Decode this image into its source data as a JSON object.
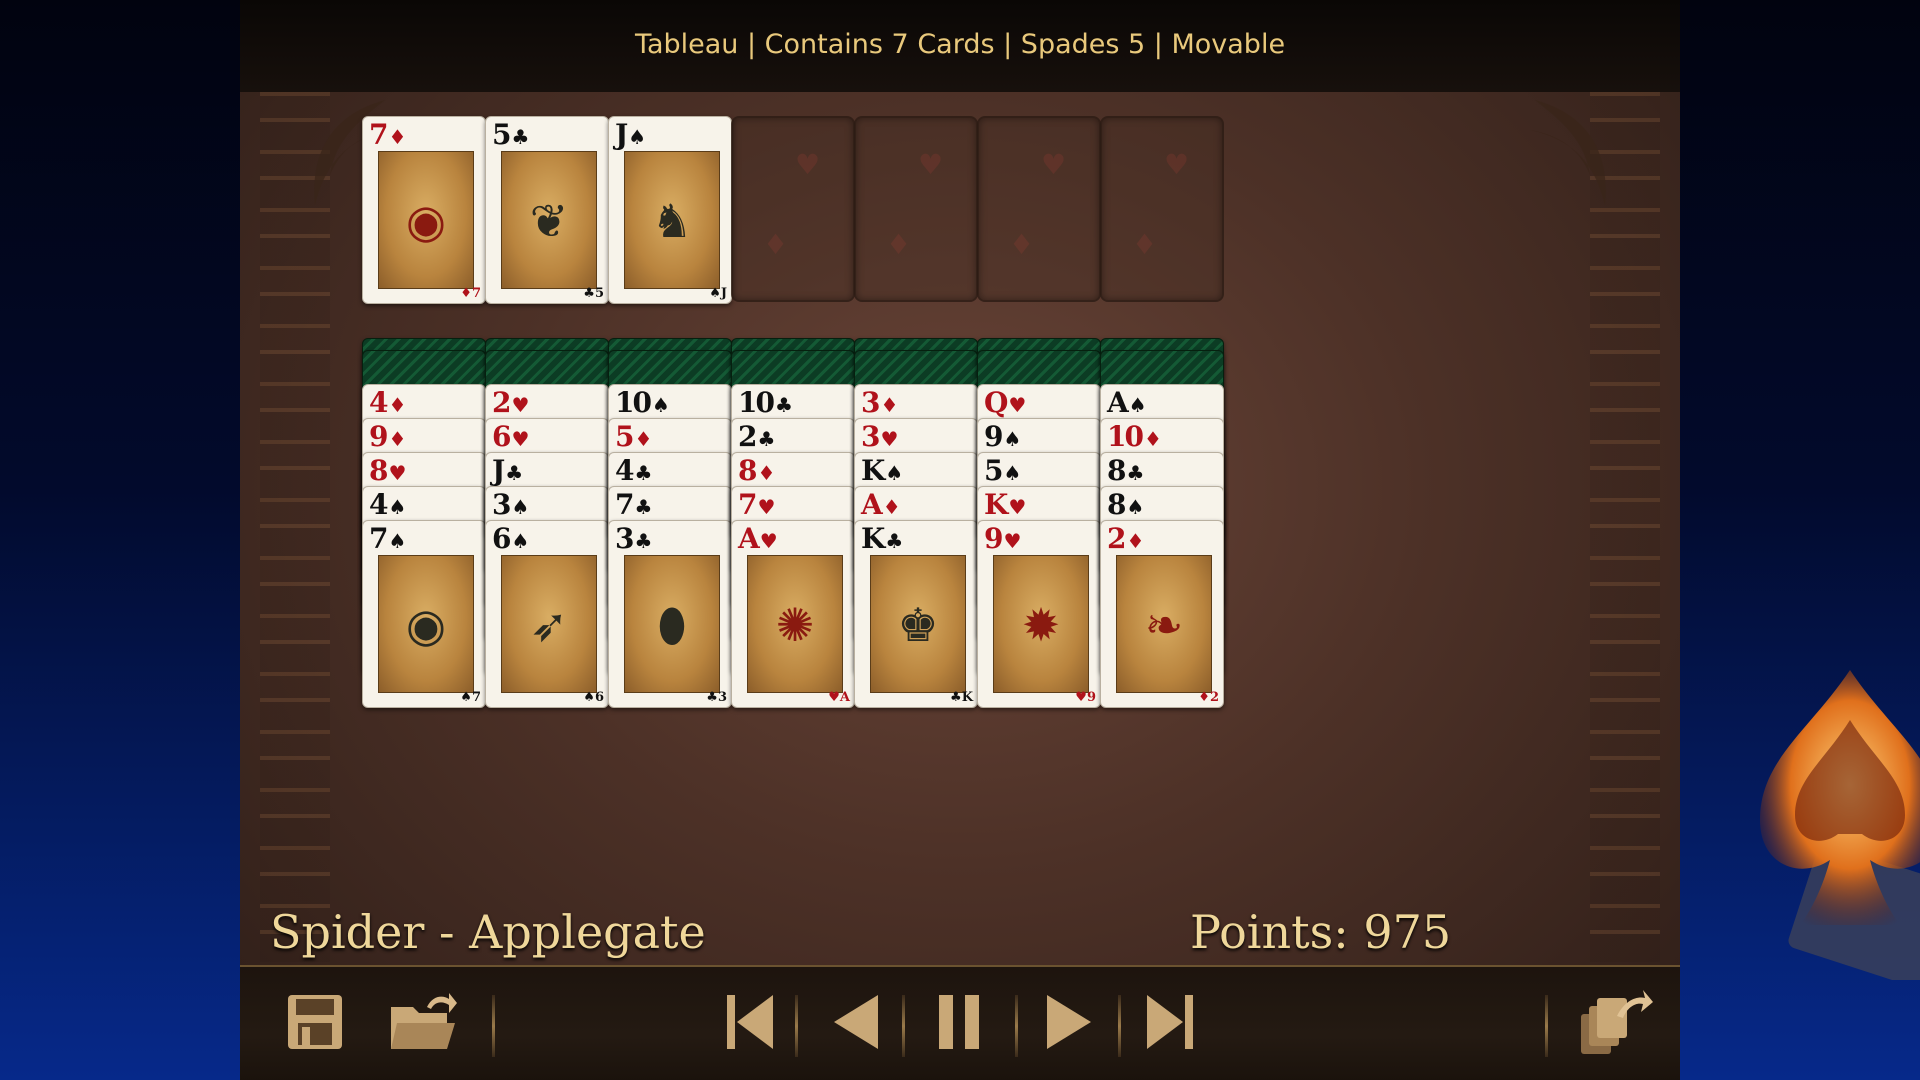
{
  "status": {
    "text": "Tableau | Contains 7 Cards | Spades 5 | Movable"
  },
  "game": {
    "title": "Spider - Applegate",
    "score_label": "Points: 975"
  },
  "colors": {
    "accent": "#e9c97c",
    "red_suit": "#b0121b",
    "black_suit": "#111111",
    "felt": "#4d3127"
  },
  "foundation": [
    {
      "rank": "7",
      "suit": "♦",
      "color": "red",
      "art": "shield"
    },
    {
      "rank": "5",
      "suit": "♣",
      "color": "black",
      "art": "necklace"
    },
    {
      "rank": "J",
      "suit": "♠",
      "color": "black",
      "art": "warrior"
    },
    {
      "empty": true
    },
    {
      "empty": true
    },
    {
      "empty": true
    },
    {
      "empty": true
    }
  ],
  "tableau": [
    {
      "facedown": 2,
      "cards": [
        {
          "rank": "4",
          "suit": "♦",
          "color": "red"
        },
        {
          "rank": "9",
          "suit": "♦",
          "color": "red"
        },
        {
          "rank": "8",
          "suit": "♥",
          "color": "red"
        },
        {
          "rank": "4",
          "suit": "♠",
          "color": "black"
        },
        {
          "rank": "7",
          "suit": "♠",
          "color": "black",
          "art": "shield"
        }
      ]
    },
    {
      "facedown": 2,
      "cards": [
        {
          "rank": "2",
          "suit": "♥",
          "color": "red"
        },
        {
          "rank": "6",
          "suit": "♥",
          "color": "red"
        },
        {
          "rank": "J",
          "suit": "♣",
          "color": "black"
        },
        {
          "rank": "3",
          "suit": "♠",
          "color": "black"
        },
        {
          "rank": "6",
          "suit": "♠",
          "color": "black",
          "art": "quiver"
        }
      ]
    },
    {
      "facedown": 2,
      "cards": [
        {
          "rank": "10",
          "suit": "♠",
          "color": "black"
        },
        {
          "rank": "5",
          "suit": "♦",
          "color": "red"
        },
        {
          "rank": "4",
          "suit": "♣",
          "color": "black"
        },
        {
          "rank": "7",
          "suit": "♣",
          "color": "black"
        },
        {
          "rank": "3",
          "suit": "♣",
          "color": "black",
          "art": "cocoa"
        }
      ]
    },
    {
      "facedown": 2,
      "cards": [
        {
          "rank": "10",
          "suit": "♣",
          "color": "black"
        },
        {
          "rank": "2",
          "suit": "♣",
          "color": "black"
        },
        {
          "rank": "8",
          "suit": "♦",
          "color": "red"
        },
        {
          "rank": "7",
          "suit": "♥",
          "color": "red"
        },
        {
          "rank": "A",
          "suit": "♥",
          "color": "red",
          "art": "parrot"
        }
      ]
    },
    {
      "facedown": 2,
      "cards": [
        {
          "rank": "3",
          "suit": "♦",
          "color": "red"
        },
        {
          "rank": "3",
          "suit": "♥",
          "color": "red"
        },
        {
          "rank": "K",
          "suit": "♠",
          "color": "black"
        },
        {
          "rank": "A",
          "suit": "♦",
          "color": "red"
        },
        {
          "rank": "K",
          "suit": "♣",
          "color": "black",
          "art": "king"
        }
      ]
    },
    {
      "facedown": 2,
      "cards": [
        {
          "rank": "Q",
          "suit": "♥",
          "color": "red"
        },
        {
          "rank": "9",
          "suit": "♠",
          "color": "black"
        },
        {
          "rank": "5",
          "suit": "♠",
          "color": "black"
        },
        {
          "rank": "K",
          "suit": "♥",
          "color": "red"
        },
        {
          "rank": "9",
          "suit": "♥",
          "color": "red",
          "art": "mask"
        }
      ]
    },
    {
      "facedown": 2,
      "cards": [
        {
          "rank": "A",
          "suit": "♠",
          "color": "black"
        },
        {
          "rank": "10",
          "suit": "♦",
          "color": "red"
        },
        {
          "rank": "8",
          "suit": "♣",
          "color": "black"
        },
        {
          "rank": "8",
          "suit": "♠",
          "color": "black"
        },
        {
          "rank": "2",
          "suit": "♦",
          "color": "red",
          "art": "corn"
        }
      ]
    }
  ],
  "toolbar": {
    "buttons": [
      "save-icon",
      "open-folder-icon",
      "first-move-icon",
      "undo-icon",
      "pause-icon",
      "redo-icon",
      "last-move-icon",
      "deal-icon"
    ]
  }
}
